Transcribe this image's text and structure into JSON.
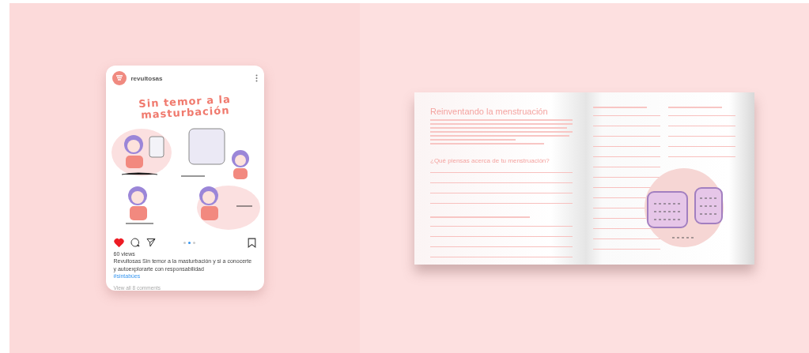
{
  "post": {
    "username": "revultosas",
    "image_title": "Sin temor a la masturbación",
    "liked": true,
    "carousel": [
      {
        "selected": false
      },
      {
        "selected": true
      },
      {
        "selected": false
      }
    ],
    "views": "60 views",
    "caption": "Revultosas Sin temor a la masturbación y si a conocerte y autoexplorarte con responsabilidad",
    "hashtag": "#sintabúes",
    "comments_link": "View all 8 comments"
  },
  "book": {
    "title": "Reinventando la menstruación",
    "question": "¿Qué piensas acerca de tu menstruación?"
  }
}
